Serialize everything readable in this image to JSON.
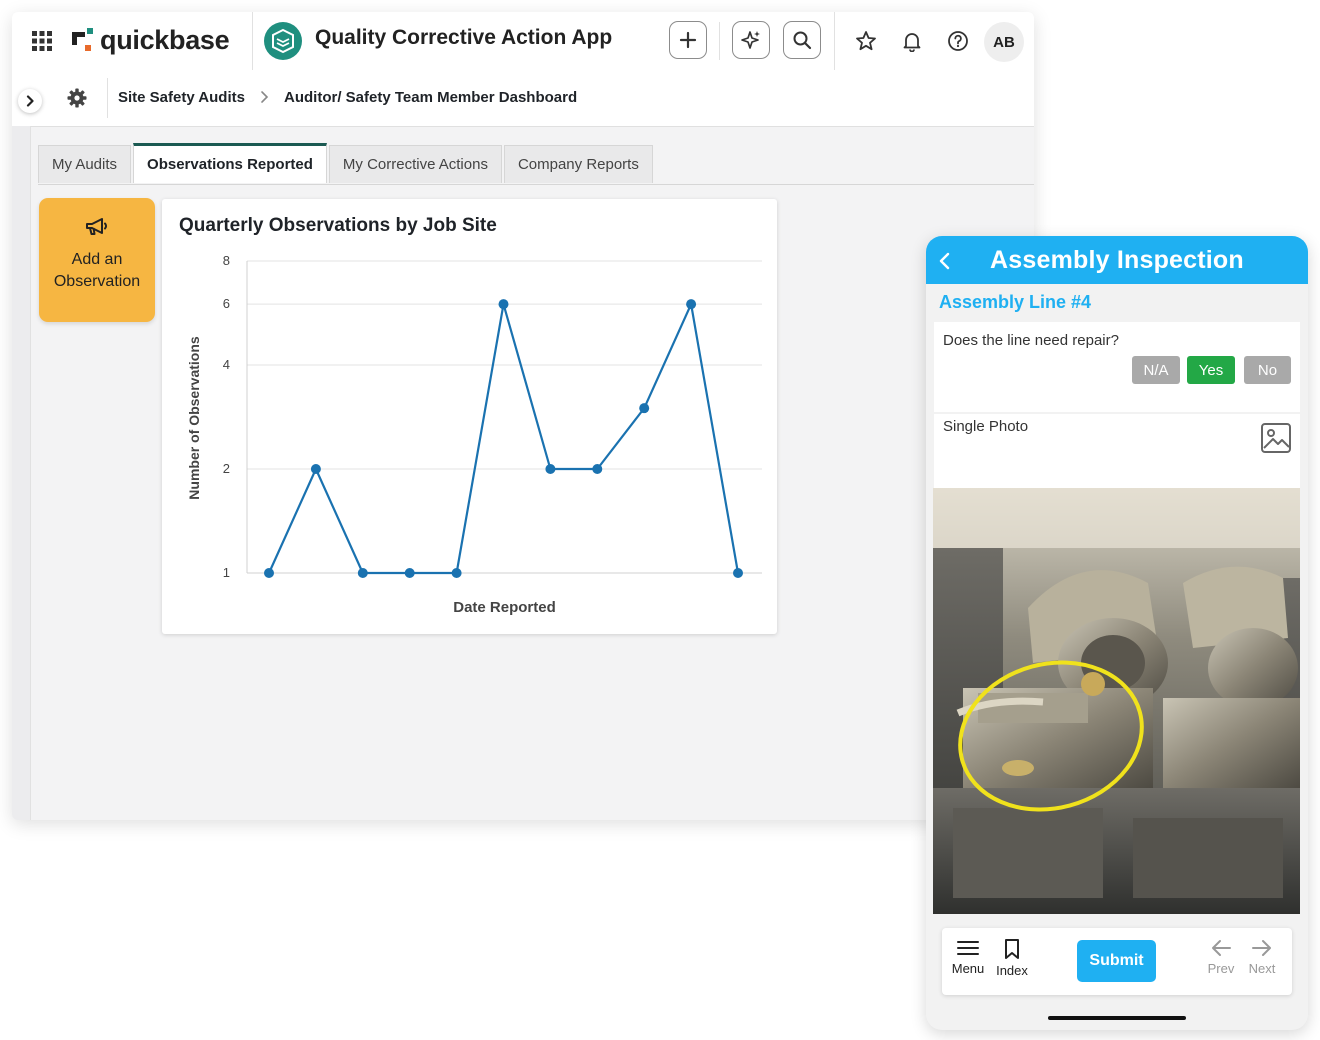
{
  "header": {
    "logo_text": "quickbase",
    "app_title": "Quality Corrective Action App",
    "avatar_initials": "AB",
    "icons": [
      "apps-grid-icon",
      "plus-icon",
      "sparkle-icon",
      "search-icon",
      "star-icon",
      "bell-icon",
      "help-icon"
    ]
  },
  "breadcrumb": {
    "items": [
      "Site Safety Audits",
      "Auditor/ Safety Team Member Dashboard"
    ]
  },
  "tabs": [
    {
      "label": "My Audits",
      "active": false
    },
    {
      "label": "Observations Reported",
      "active": true
    },
    {
      "label": "My Corrective Actions",
      "active": false
    },
    {
      "label": "Company Reports",
      "active": false
    }
  ],
  "add_button": {
    "line1": "Add an",
    "line2": "Observation"
  },
  "chart_data": {
    "type": "line",
    "title": "Quarterly Observations by Job Site",
    "xlabel": "Date Reported",
    "ylabel": "Number of Observations",
    "y_scale": "log",
    "y_ticks": [
      1,
      2,
      4,
      6,
      8
    ],
    "ylim": [
      1,
      8
    ],
    "values": [
      1,
      2,
      1,
      1,
      1,
      6,
      2,
      2,
      3,
      6,
      1
    ],
    "color": "#1a72b0",
    "grid": true
  },
  "mobile": {
    "title": "Assembly Inspection",
    "section": "Assembly Line #4",
    "question": "Does the line need repair?",
    "options": [
      {
        "label": "N/A",
        "selected": false
      },
      {
        "label": "Yes",
        "selected": true
      },
      {
        "label": "No",
        "selected": false
      }
    ],
    "photo_label": "Single Photo",
    "footer": {
      "menu": "Menu",
      "index": "Index",
      "submit": "Submit",
      "prev": "Prev",
      "next": "Next"
    },
    "colors": {
      "accent": "#1fb0f2",
      "selected": "#23a846",
      "unselected": "#a9a9a9"
    }
  }
}
